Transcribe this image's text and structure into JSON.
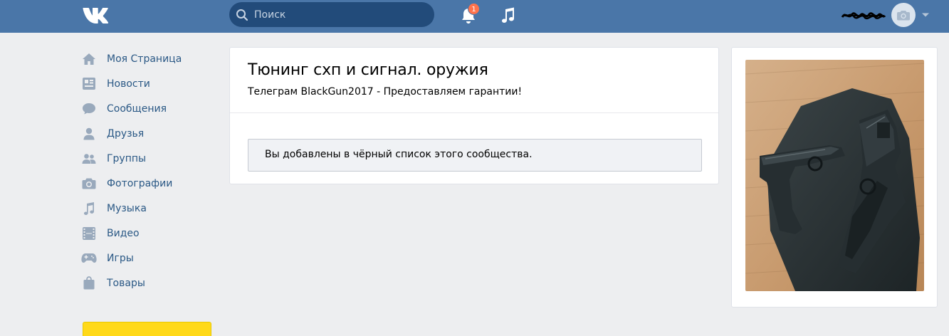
{
  "header": {
    "search_placeholder": "Поиск",
    "notification_count": "1",
    "colors": {
      "header_bg": "#4a76a8",
      "search_bg": "#224b7a",
      "badge": "#ff734c"
    }
  },
  "sidebar": {
    "items": [
      {
        "label": "Моя Страница",
        "icon": "home-icon"
      },
      {
        "label": "Новости",
        "icon": "news-icon"
      },
      {
        "label": "Сообщения",
        "icon": "messages-icon"
      },
      {
        "label": "Друзья",
        "icon": "friend-icon"
      },
      {
        "label": "Группы",
        "icon": "groups-icon"
      },
      {
        "label": "Фотографии",
        "icon": "camera-icon"
      },
      {
        "label": "Музыка",
        "icon": "music-note-icon"
      },
      {
        "label": "Видео",
        "icon": "film-icon"
      },
      {
        "label": "Игры",
        "icon": "gamepad-icon"
      },
      {
        "label": "Товары",
        "icon": "shopping-bag-icon"
      }
    ]
  },
  "group": {
    "title": "Тюнинг схп и сигнал. оружия",
    "status": "Телеграм BlackGun2017 - Предоставляем гарантии!",
    "notice": "Вы добавлены в чёрный список этого сообщества."
  }
}
